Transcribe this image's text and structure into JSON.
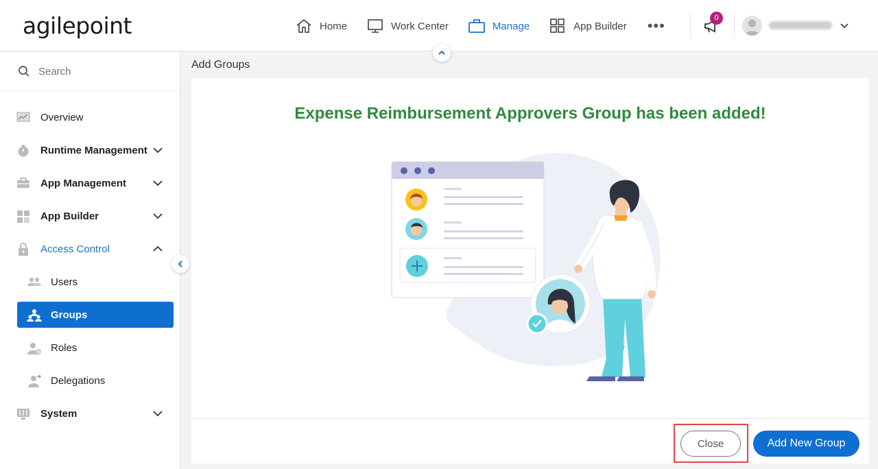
{
  "brand": {
    "logo_text": "agilepoint"
  },
  "nav": {
    "items": [
      {
        "label": "Home",
        "icon": "home-icon",
        "active": false
      },
      {
        "label": "Work Center",
        "icon": "monitor-icon",
        "active": false
      },
      {
        "label": "Manage",
        "icon": "briefcase-icon",
        "active": true
      },
      {
        "label": "App Builder",
        "icon": "grid-icon",
        "active": false
      }
    ],
    "more_label": "•••",
    "notification_count": "0"
  },
  "sidebar": {
    "search_placeholder": "Search",
    "items": [
      {
        "label": "Overview"
      },
      {
        "label": "Runtime Management"
      },
      {
        "label": "App Management"
      },
      {
        "label": "App Builder"
      },
      {
        "label": "Access Control"
      },
      {
        "label": "Users"
      },
      {
        "label": "Groups"
      },
      {
        "label": "Roles"
      },
      {
        "label": "Delegations"
      },
      {
        "label": "System"
      }
    ]
  },
  "main": {
    "page_title": "Add Groups",
    "success_message": "Expense Reimbursement Approvers Group has been added!"
  },
  "footer": {
    "close_label": "Close",
    "add_new_label": "Add New Group"
  },
  "colors": {
    "accent": "#0e6fd1",
    "success": "#2e8b3e",
    "badge": "#b3207c",
    "highlight": "#e0473f"
  }
}
